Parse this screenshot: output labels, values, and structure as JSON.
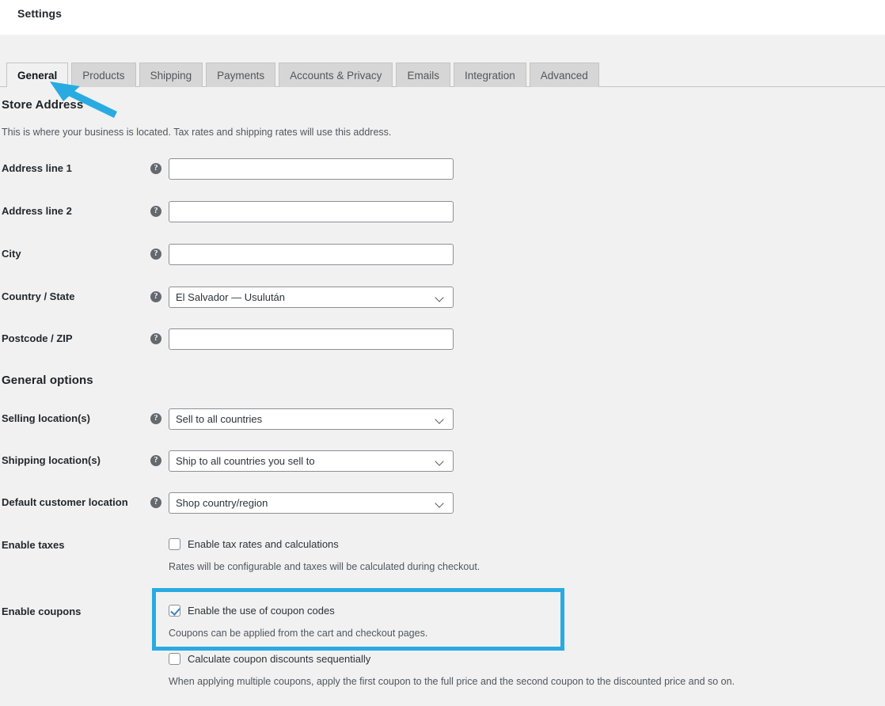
{
  "header": {
    "title": "Settings"
  },
  "tabs": [
    {
      "label": "General",
      "active": true
    },
    {
      "label": "Products",
      "active": false
    },
    {
      "label": "Shipping",
      "active": false
    },
    {
      "label": "Payments",
      "active": false
    },
    {
      "label": "Accounts & Privacy",
      "active": false
    },
    {
      "label": "Emails",
      "active": false
    },
    {
      "label": "Integration",
      "active": false
    },
    {
      "label": "Advanced",
      "active": false
    }
  ],
  "store_address": {
    "title": "Store Address",
    "description": "This is where your business is located. Tax rates and shipping rates will use this address.",
    "fields": [
      {
        "label": "Address line 1",
        "type": "text",
        "value": "",
        "help": "?"
      },
      {
        "label": "Address line 2",
        "type": "text",
        "value": "",
        "help": "?"
      },
      {
        "label": "City",
        "type": "text",
        "value": "",
        "help": "?"
      },
      {
        "label": "Country / State",
        "type": "select",
        "value": "El Salvador — Usulután",
        "help": "?"
      },
      {
        "label": "Postcode / ZIP",
        "type": "text",
        "value": "",
        "help": "?"
      }
    ]
  },
  "general_options": {
    "title": "General options",
    "selects": [
      {
        "label": "Selling location(s)",
        "value": "Sell to all countries",
        "help": "?"
      },
      {
        "label": "Shipping location(s)",
        "value": "Ship to all countries you sell to",
        "help": "?"
      },
      {
        "label": "Default customer location",
        "value": "Shop country/region",
        "help": "?"
      }
    ],
    "enable_taxes": {
      "label": "Enable taxes",
      "checkbox_label": "Enable tax rates and calculations",
      "checked": false,
      "description": "Rates will be configurable and taxes will be calculated during checkout.",
      "help": "?"
    },
    "enable_coupons": {
      "label": "Enable coupons",
      "checkbox_label": "Enable the use of coupon codes",
      "checked": true,
      "description": "Coupons can be applied from the cart and checkout pages.",
      "sequential_label": "Calculate coupon discounts sequentially",
      "sequential_checked": false,
      "sequential_description": "When applying multiple coupons, apply the first coupon to the full price and the second coupon to the discounted price and so on.",
      "help": "?"
    }
  },
  "annotations": {
    "highlight_color": "#29abe2",
    "arrow_color": "#29abe2",
    "arrow_target": "General tab",
    "highlight_target": "Enable the use of coupon codes"
  }
}
